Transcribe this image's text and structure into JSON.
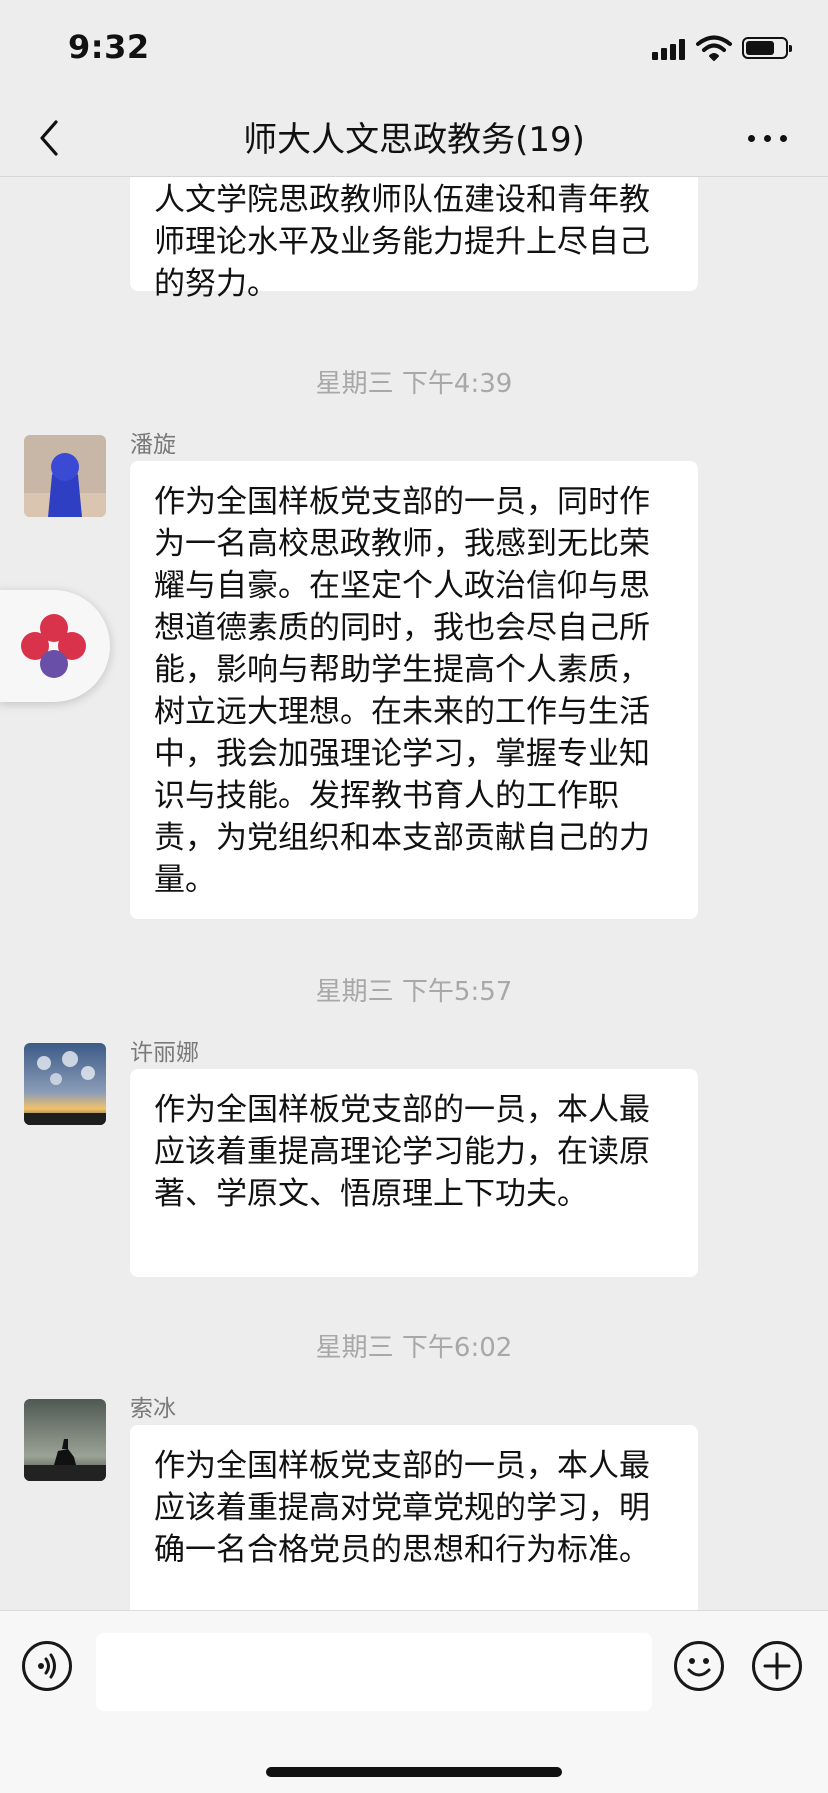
{
  "status": {
    "time": "9:32"
  },
  "header": {
    "title": "师大人文思政教务(19)",
    "back_icon": "chevron-left-icon",
    "more_icon": "ellipsis-icon"
  },
  "messages": {
    "partial_text": "人文学院思政教师队伍建设和青年教师理论水平及业务能力提升上尽自己的努力。",
    "group1": {
      "timestamp": "星期三 下午4:39",
      "sender": "潘旋",
      "text": "作为全国样板党支部的一员，同时作为一名高校思政教师，我感到无比荣耀与自豪。在坚定个人政治信仰与思想道德素质的同时，我也会尽自己所能，影响与帮助学生提高个人素质，树立远大理想。在未来的工作与生活中，我会加强理论学习，掌握专业知识与技能。发挥教书育人的工作职责，为党组织和本支部贡献自己的力量。"
    },
    "group2": {
      "timestamp": "星期三 下午5:57",
      "sender": "许丽娜",
      "text": "作为全国样板党支部的一员，本人最应该着重提高理论学习能力，在读原著、学原文、悟原理上下功夫。"
    },
    "group3": {
      "timestamp": "星期三 下午6:02",
      "sender": "索冰",
      "text": "作为全国样板党支部的一员，本人最应该着重提高对党章党规的学习，明确一名合格党员的思想和行为标准。"
    }
  },
  "input": {
    "value": "",
    "voice_icon": "voice-icon",
    "emoji_icon": "emoji-icon",
    "add_icon": "plus-icon"
  },
  "colors": {
    "background": "#ededed",
    "bubble": "#ffffff",
    "timestamp": "#a8a8a8"
  }
}
